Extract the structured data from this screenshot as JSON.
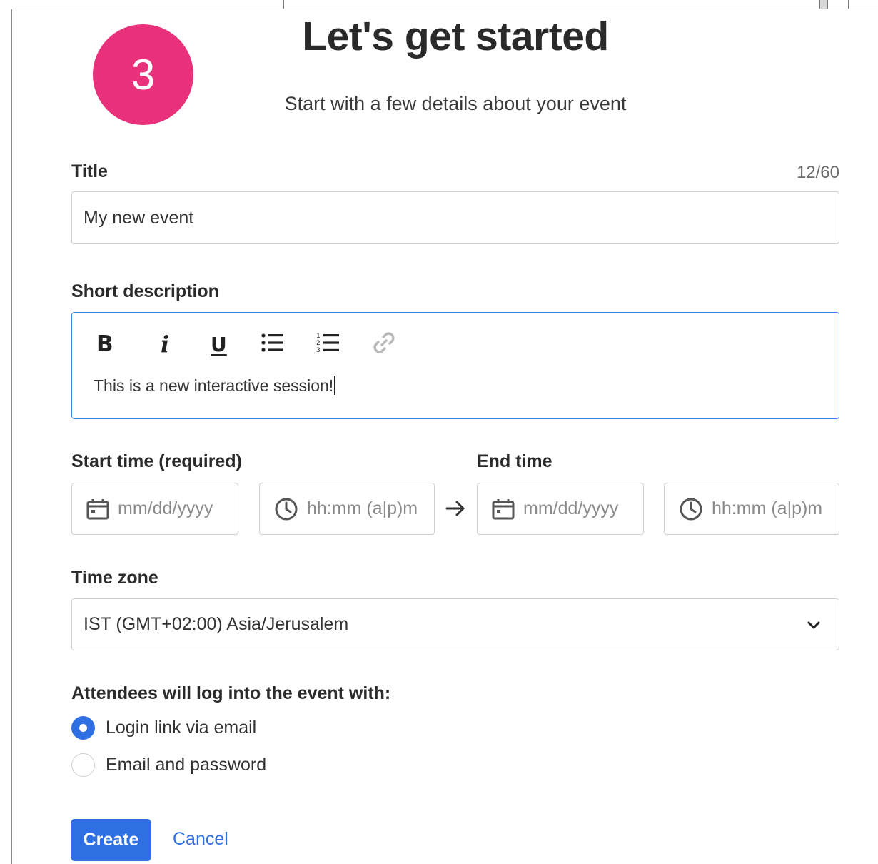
{
  "header": {
    "step_number": "3",
    "title": "Let's get started",
    "subtitle": "Start with a few details about your event"
  },
  "title_field": {
    "label": "Title",
    "counter": "12/60",
    "value": "My new event"
  },
  "description_field": {
    "label": "Short description",
    "toolbar": {
      "bold": "B",
      "italic": "i",
      "underline": "U",
      "icons": [
        "bullet-list-icon",
        "numbered-list-icon",
        "link-icon"
      ]
    },
    "value": "This is a new interactive session!"
  },
  "time": {
    "start_label": "Start time (required)",
    "end_label": "End time",
    "start_date_placeholder": "mm/dd/yyyy",
    "start_time_placeholder": "hh:mm (a|p)m",
    "end_date_placeholder": "mm/dd/yyyy",
    "end_time_placeholder": "hh:mm (a|p)m"
  },
  "timezone": {
    "label": "Time zone",
    "selected": "IST (GMT+02:00) Asia/Jerusalem"
  },
  "login": {
    "label": "Attendees will log into the event with:",
    "options": [
      {
        "label": "Login link via email",
        "checked": true
      },
      {
        "label": "Email and password",
        "checked": false
      }
    ]
  },
  "actions": {
    "create_label": "Create",
    "cancel_label": "Cancel"
  },
  "colors": {
    "accent": "#2f6fe4",
    "badge": "#e8317a",
    "focus_border": "#3b82e8"
  }
}
